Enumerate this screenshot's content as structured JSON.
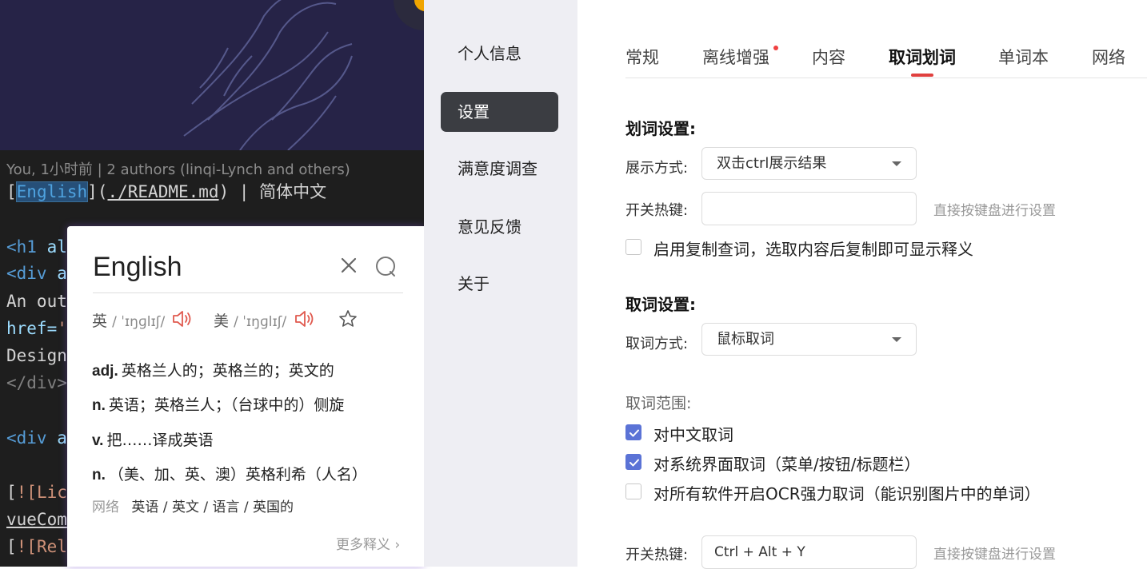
{
  "editor": {
    "blame": "You, 1小时前 | 2 authors (linqi-Lynch and others)",
    "line1": {
      "open": "[",
      "selected": "English",
      "close": "]",
      "paren_open": "(",
      "link": "./README.md",
      "paren_close": ")",
      "rest": " | 简体中文"
    },
    "lines": [
      {
        "tag": "<h1",
        "tail": " al"
      },
      {
        "tag": "<div",
        "tail": " a"
      },
      {
        "text": "An out"
      },
      {
        "attr": "href=",
        "str": "'"
      },
      {
        "text": "Design"
      },
      {
        "tag": "</div",
        "tail": ">"
      },
      {
        "tag": "<div",
        "tail": " a"
      },
      {
        "bracket": "[",
        "str": "![Lic"
      },
      {
        "text": "vueCom"
      },
      {
        "bracket": "[",
        "str": "![Rel"
      }
    ]
  },
  "popup": {
    "word": "English",
    "uk_label": "英",
    "uk_ipa": "/ ˈɪŋɡlɪʃ/",
    "us_label": "美",
    "us_ipa": "/ ˈɪŋɡlɪʃ/",
    "definitions": [
      {
        "pos": "adj.",
        "text": "英格兰人的；英格兰的；英文的"
      },
      {
        "pos": "n.",
        "text": "英语；英格兰人；（台球中的）侧旋"
      },
      {
        "pos": "v.",
        "text": "把……译成英语"
      },
      {
        "pos": "n.",
        "text": "（美、加、英、澳）英格利希（人名）"
      }
    ],
    "net_label": "网络",
    "net_values": "英语 / 英文 / 语言 / 英国的",
    "more_label": "更多释义 ›"
  },
  "nav": {
    "items": [
      "个人信息",
      "设置",
      "满意度调查",
      "意见反馈",
      "关于"
    ],
    "active_index": 1
  },
  "tabs": {
    "items": [
      "常规",
      "离线增强",
      "内容",
      "取词划词",
      "单词本",
      "网络"
    ],
    "active_index": 3,
    "dot_on": "离线增强"
  },
  "highlight": {
    "title": "划词设置:",
    "display_label": "展示方式:",
    "display_value": "双击ctrl展示结果",
    "hotkey_label": "开关热键:",
    "hotkey_value": "",
    "hotkey_hint": "直接按键盘进行设置",
    "copy_lookup_label": "启用复制查词，选取内容后复制即可显示释义",
    "copy_lookup_checked": false
  },
  "capture": {
    "title": "取词设置:",
    "mode_label": "取词方式:",
    "mode_value": "鼠标取词",
    "range_label": "取词范围:",
    "options": [
      {
        "label": "对中文取词",
        "checked": true
      },
      {
        "label": "对系统界面取词（菜单/按钮/标题栏）",
        "checked": true
      },
      {
        "label": "对所有软件开启OCR强力取词（能识别图片中的单词）",
        "checked": false
      }
    ],
    "hotkey_label": "开关热键:",
    "hotkey_value": "Ctrl + Alt + Y",
    "hotkey_hint": "直接按键盘进行设置"
  },
  "colors": {
    "accent_red": "#e0403e",
    "checkbox_blue": "#5b73d6",
    "nav_active": "#3b3d42",
    "speaker_red": "#e05a4f"
  }
}
